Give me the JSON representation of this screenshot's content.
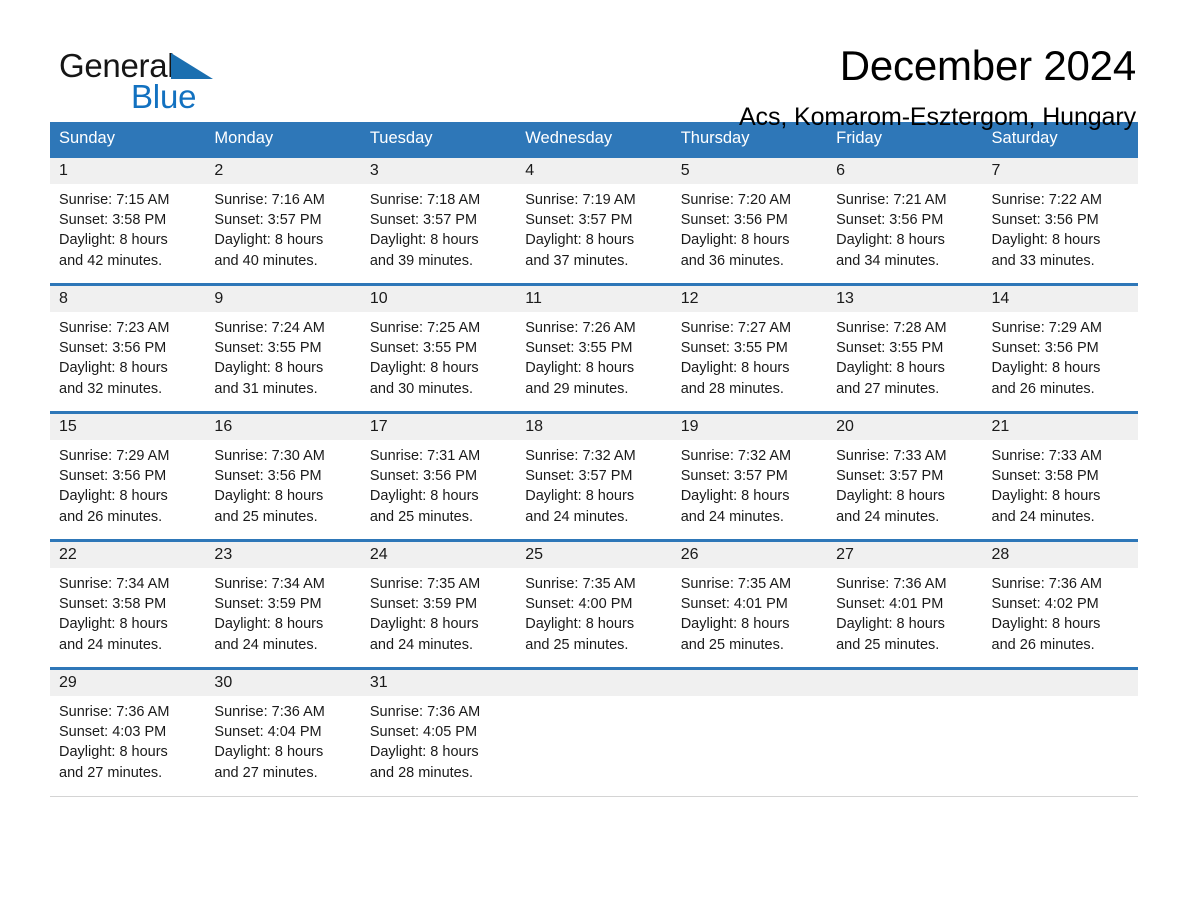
{
  "brand": {
    "name_part1": "General",
    "name_part2": "Blue",
    "logo_icon": "blue-triangle",
    "color_blue": "#1271c0"
  },
  "header": {
    "title": "December 2024",
    "subtitle": "Acs, Komarom-Esztergom, Hungary"
  },
  "theme": {
    "header_blue": "#2e77b8",
    "daynum_band": "#f0f0f0",
    "text": "#1a1a1a"
  },
  "calendar": {
    "day_headers": [
      "Sunday",
      "Monday",
      "Tuesday",
      "Wednesday",
      "Thursday",
      "Friday",
      "Saturday"
    ],
    "weeks": [
      [
        {
          "day": "1",
          "sunrise": "Sunrise: 7:15 AM",
          "sunset": "Sunset: 3:58 PM",
          "daylight_line1": "Daylight: 8 hours",
          "daylight_line2": "and 42 minutes."
        },
        {
          "day": "2",
          "sunrise": "Sunrise: 7:16 AM",
          "sunset": "Sunset: 3:57 PM",
          "daylight_line1": "Daylight: 8 hours",
          "daylight_line2": "and 40 minutes."
        },
        {
          "day": "3",
          "sunrise": "Sunrise: 7:18 AM",
          "sunset": "Sunset: 3:57 PM",
          "daylight_line1": "Daylight: 8 hours",
          "daylight_line2": "and 39 minutes."
        },
        {
          "day": "4",
          "sunrise": "Sunrise: 7:19 AM",
          "sunset": "Sunset: 3:57 PM",
          "daylight_line1": "Daylight: 8 hours",
          "daylight_line2": "and 37 minutes."
        },
        {
          "day": "5",
          "sunrise": "Sunrise: 7:20 AM",
          "sunset": "Sunset: 3:56 PM",
          "daylight_line1": "Daylight: 8 hours",
          "daylight_line2": "and 36 minutes."
        },
        {
          "day": "6",
          "sunrise": "Sunrise: 7:21 AM",
          "sunset": "Sunset: 3:56 PM",
          "daylight_line1": "Daylight: 8 hours",
          "daylight_line2": "and 34 minutes."
        },
        {
          "day": "7",
          "sunrise": "Sunrise: 7:22 AM",
          "sunset": "Sunset: 3:56 PM",
          "daylight_line1": "Daylight: 8 hours",
          "daylight_line2": "and 33 minutes."
        }
      ],
      [
        {
          "day": "8",
          "sunrise": "Sunrise: 7:23 AM",
          "sunset": "Sunset: 3:56 PM",
          "daylight_line1": "Daylight: 8 hours",
          "daylight_line2": "and 32 minutes."
        },
        {
          "day": "9",
          "sunrise": "Sunrise: 7:24 AM",
          "sunset": "Sunset: 3:55 PM",
          "daylight_line1": "Daylight: 8 hours",
          "daylight_line2": "and 31 minutes."
        },
        {
          "day": "10",
          "sunrise": "Sunrise: 7:25 AM",
          "sunset": "Sunset: 3:55 PM",
          "daylight_line1": "Daylight: 8 hours",
          "daylight_line2": "and 30 minutes."
        },
        {
          "day": "11",
          "sunrise": "Sunrise: 7:26 AM",
          "sunset": "Sunset: 3:55 PM",
          "daylight_line1": "Daylight: 8 hours",
          "daylight_line2": "and 29 minutes."
        },
        {
          "day": "12",
          "sunrise": "Sunrise: 7:27 AM",
          "sunset": "Sunset: 3:55 PM",
          "daylight_line1": "Daylight: 8 hours",
          "daylight_line2": "and 28 minutes."
        },
        {
          "day": "13",
          "sunrise": "Sunrise: 7:28 AM",
          "sunset": "Sunset: 3:55 PM",
          "daylight_line1": "Daylight: 8 hours",
          "daylight_line2": "and 27 minutes."
        },
        {
          "day": "14",
          "sunrise": "Sunrise: 7:29 AM",
          "sunset": "Sunset: 3:56 PM",
          "daylight_line1": "Daylight: 8 hours",
          "daylight_line2": "and 26 minutes."
        }
      ],
      [
        {
          "day": "15",
          "sunrise": "Sunrise: 7:29 AM",
          "sunset": "Sunset: 3:56 PM",
          "daylight_line1": "Daylight: 8 hours",
          "daylight_line2": "and 26 minutes."
        },
        {
          "day": "16",
          "sunrise": "Sunrise: 7:30 AM",
          "sunset": "Sunset: 3:56 PM",
          "daylight_line1": "Daylight: 8 hours",
          "daylight_line2": "and 25 minutes."
        },
        {
          "day": "17",
          "sunrise": "Sunrise: 7:31 AM",
          "sunset": "Sunset: 3:56 PM",
          "daylight_line1": "Daylight: 8 hours",
          "daylight_line2": "and 25 minutes."
        },
        {
          "day": "18",
          "sunrise": "Sunrise: 7:32 AM",
          "sunset": "Sunset: 3:57 PM",
          "daylight_line1": "Daylight: 8 hours",
          "daylight_line2": "and 24 minutes."
        },
        {
          "day": "19",
          "sunrise": "Sunrise: 7:32 AM",
          "sunset": "Sunset: 3:57 PM",
          "daylight_line1": "Daylight: 8 hours",
          "daylight_line2": "and 24 minutes."
        },
        {
          "day": "20",
          "sunrise": "Sunrise: 7:33 AM",
          "sunset": "Sunset: 3:57 PM",
          "daylight_line1": "Daylight: 8 hours",
          "daylight_line2": "and 24 minutes."
        },
        {
          "day": "21",
          "sunrise": "Sunrise: 7:33 AM",
          "sunset": "Sunset: 3:58 PM",
          "daylight_line1": "Daylight: 8 hours",
          "daylight_line2": "and 24 minutes."
        }
      ],
      [
        {
          "day": "22",
          "sunrise": "Sunrise: 7:34 AM",
          "sunset": "Sunset: 3:58 PM",
          "daylight_line1": "Daylight: 8 hours",
          "daylight_line2": "and 24 minutes."
        },
        {
          "day": "23",
          "sunrise": "Sunrise: 7:34 AM",
          "sunset": "Sunset: 3:59 PM",
          "daylight_line1": "Daylight: 8 hours",
          "daylight_line2": "and 24 minutes."
        },
        {
          "day": "24",
          "sunrise": "Sunrise: 7:35 AM",
          "sunset": "Sunset: 3:59 PM",
          "daylight_line1": "Daylight: 8 hours",
          "daylight_line2": "and 24 minutes."
        },
        {
          "day": "25",
          "sunrise": "Sunrise: 7:35 AM",
          "sunset": "Sunset: 4:00 PM",
          "daylight_line1": "Daylight: 8 hours",
          "daylight_line2": "and 25 minutes."
        },
        {
          "day": "26",
          "sunrise": "Sunrise: 7:35 AM",
          "sunset": "Sunset: 4:01 PM",
          "daylight_line1": "Daylight: 8 hours",
          "daylight_line2": "and 25 minutes."
        },
        {
          "day": "27",
          "sunrise": "Sunrise: 7:36 AM",
          "sunset": "Sunset: 4:01 PM",
          "daylight_line1": "Daylight: 8 hours",
          "daylight_line2": "and 25 minutes."
        },
        {
          "day": "28",
          "sunrise": "Sunrise: 7:36 AM",
          "sunset": "Sunset: 4:02 PM",
          "daylight_line1": "Daylight: 8 hours",
          "daylight_line2": "and 26 minutes."
        }
      ],
      [
        {
          "day": "29",
          "sunrise": "Sunrise: 7:36 AM",
          "sunset": "Sunset: 4:03 PM",
          "daylight_line1": "Daylight: 8 hours",
          "daylight_line2": "and 27 minutes."
        },
        {
          "day": "30",
          "sunrise": "Sunrise: 7:36 AM",
          "sunset": "Sunset: 4:04 PM",
          "daylight_line1": "Daylight: 8 hours",
          "daylight_line2": "and 27 minutes."
        },
        {
          "day": "31",
          "sunrise": "Sunrise: 7:36 AM",
          "sunset": "Sunset: 4:05 PM",
          "daylight_line1": "Daylight: 8 hours",
          "daylight_line2": "and 28 minutes."
        },
        {
          "day": "",
          "sunrise": "",
          "sunset": "",
          "daylight_line1": "",
          "daylight_line2": ""
        },
        {
          "day": "",
          "sunrise": "",
          "sunset": "",
          "daylight_line1": "",
          "daylight_line2": ""
        },
        {
          "day": "",
          "sunrise": "",
          "sunset": "",
          "daylight_line1": "",
          "daylight_line2": ""
        },
        {
          "day": "",
          "sunrise": "",
          "sunset": "",
          "daylight_line1": "",
          "daylight_line2": ""
        }
      ]
    ]
  }
}
